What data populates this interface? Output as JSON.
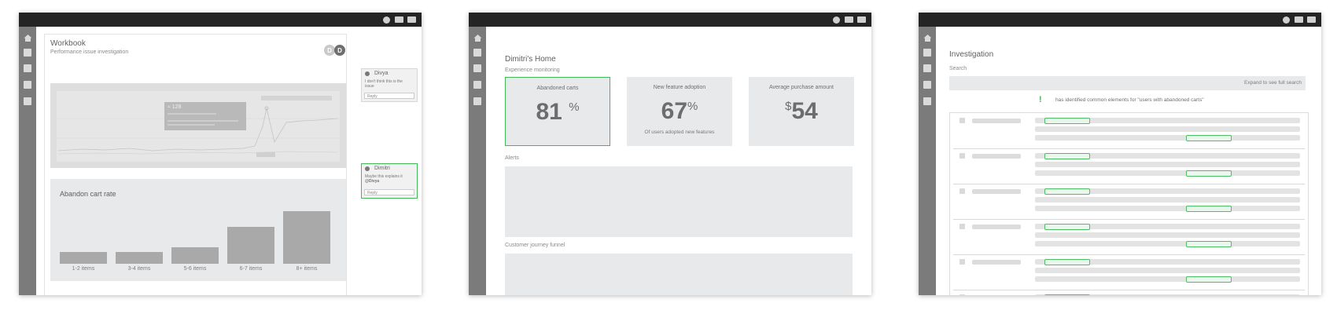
{
  "window1": {
    "title": "Workbook",
    "subtitle": "Performance issue investigation",
    "avatars": [
      "D",
      "D"
    ],
    "chart_tooltip_value": "≈ 128",
    "chart_title": "Abandon cart rate",
    "comments": [
      {
        "name": "Divya",
        "text": "I don't think this is the issue",
        "reply": "Reply"
      },
      {
        "name": "Dimitri",
        "text": "Maybe this explains it",
        "mention": "@Divya",
        "reply": "Reply"
      }
    ]
  },
  "chart_data": {
    "type": "bar",
    "title": "Abandon cart rate",
    "categories": [
      "1-2 items",
      "3-4 items",
      "5-6 items",
      "6-7 items",
      "8+ items"
    ],
    "values": [
      18,
      18,
      25,
      56,
      80
    ],
    "ylim": [
      0,
      100
    ],
    "xlabel": "",
    "ylabel": "",
    "grid": false,
    "color": "#a9a9a9"
  },
  "window2": {
    "title": "Dimitri's Home",
    "section_label": "Experience monitoring",
    "kpis": [
      {
        "label": "Abandoned carts",
        "value": "81",
        "unit": "%",
        "note": ""
      },
      {
        "label": "New feature adoption",
        "value": "67",
        "unit": "%",
        "note": "Of users adopted new features"
      },
      {
        "label": "Average purchase amount",
        "value": "54",
        "prefix": "$",
        "note": ""
      }
    ],
    "alerts_label": "Alerts",
    "funnel_label": "Customer journey funnel"
  },
  "window3": {
    "title": "Investigation",
    "search_label": "Search",
    "search_hint": "Expand to see full search",
    "notice_icon": "!",
    "notice_text": "has identified common elements for \"users with abandoned carts\""
  },
  "colors": {
    "accent_green": "#41b85a",
    "titlebar": "#242424",
    "sidebar": "#7b7b7b",
    "panel_gray": "#e8e9ea"
  }
}
